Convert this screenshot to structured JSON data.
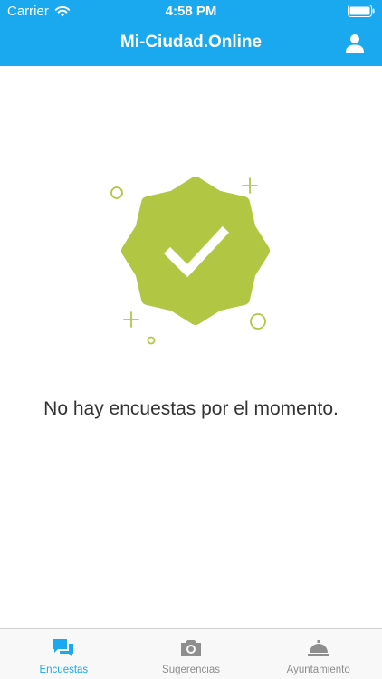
{
  "status_bar": {
    "carrier": "Carrier",
    "time": "4:58 PM"
  },
  "header": {
    "title": "Mi-Ciudad.Online",
    "icon": "user-icon"
  },
  "content": {
    "empty_message": "No hay encuestas por el momento.",
    "illustration": "verified-badge-check-icon"
  },
  "tabs": [
    {
      "label": "Encuestas",
      "icon": "chat-bubbles-icon",
      "active": true
    },
    {
      "label": "Sugerencias",
      "icon": "camera-icon",
      "active": false
    },
    {
      "label": "Ayuntamiento",
      "icon": "service-bell-icon",
      "active": false
    }
  ],
  "colors": {
    "brand": "#1aa9ee",
    "badge": "#b1c744",
    "inactive_tab": "#8e8e8e"
  }
}
